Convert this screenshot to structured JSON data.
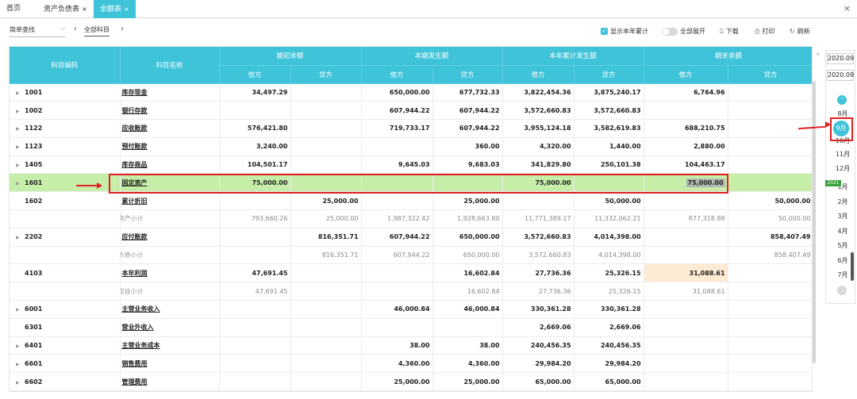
{
  "tabs": [
    {
      "label": "首页",
      "closable": false,
      "active": false
    },
    {
      "label": "资产负债表",
      "closable": true,
      "active": false
    },
    {
      "label": "余额表",
      "closable": true,
      "active": true
    }
  ],
  "close_glyph": "×",
  "toolbar": {
    "search_label": "简单查找",
    "subject_filter": "全部科目",
    "show_year_total_label": "显示本年累计",
    "show_year_total_checked": true,
    "expand_all_label": "全部展开",
    "download_label": "下载",
    "print_label": "打印",
    "refresh_label": "刷新"
  },
  "table": {
    "headers": {
      "code": "科目编码",
      "name": "科目名称",
      "groups": [
        "期初余额",
        "本期发生额",
        "本年累计发生额",
        "期末余额"
      ],
      "debit": "借方",
      "credit": "贷方"
    },
    "rows": [
      {
        "code": "1001",
        "expandable": true,
        "name": "库存现金",
        "type": "account",
        "values": [
          "34,497.29",
          "",
          "650,000.00",
          "677,732.33",
          "3,822,454.36",
          "3,875,240.17",
          "6,764.96",
          ""
        ]
      },
      {
        "code": "1002",
        "expandable": true,
        "name": "银行存款",
        "type": "account",
        "values": [
          "",
          "",
          "607,944.22",
          "607,944.22",
          "3,572,660.83",
          "3,572,660.83",
          "",
          ""
        ]
      },
      {
        "code": "1122",
        "expandable": true,
        "name": "应收账款",
        "type": "account",
        "values": [
          "576,421.80",
          "",
          "719,733.17",
          "607,944.22",
          "3,955,124.18",
          "3,582,619.83",
          "688,210.75",
          ""
        ]
      },
      {
        "code": "1123",
        "expandable": true,
        "name": "预付账款",
        "type": "account",
        "values": [
          "3,240.00",
          "",
          "",
          "360.00",
          "4,320.00",
          "1,440.00",
          "2,880.00",
          ""
        ]
      },
      {
        "code": "1405",
        "expandable": true,
        "name": "库存商品",
        "type": "account",
        "values": [
          "104,501.17",
          "",
          "9,645.03",
          "9,683.03",
          "341,829.80",
          "250,101.38",
          "104,463.17",
          ""
        ]
      },
      {
        "code": "1601",
        "expandable": true,
        "name": "固定资产",
        "type": "highlight",
        "values": [
          "75,000.00",
          "",
          "",
          "",
          "75,000.00",
          "",
          "75,000.00",
          ""
        ]
      },
      {
        "code": "1602",
        "expandable": false,
        "name": "累计折旧",
        "type": "account",
        "values": [
          "",
          "25,000.00",
          "",
          "25,000.00",
          "",
          "50,000.00",
          "",
          "50,000.00"
        ]
      },
      {
        "code": "",
        "expandable": false,
        "name": "资产小计",
        "type": "subtotal",
        "values": [
          "793,660.26",
          "25,000.00",
          "1,987,322.42",
          "1,928,663.80",
          "11,771,389.17",
          "11,332,062.21",
          "877,318.88",
          "50,000.00"
        ]
      },
      {
        "code": "2202",
        "expandable": true,
        "name": "应付账款",
        "type": "account",
        "values": [
          "",
          "816,351.71",
          "607,944.22",
          "650,000.00",
          "3,572,660.83",
          "4,014,398.00",
          "",
          "858,407.49"
        ]
      },
      {
        "code": "",
        "expandable": false,
        "name": "负债小计",
        "type": "subtotal",
        "values": [
          "",
          "816,351.71",
          "607,944.22",
          "650,000.00",
          "3,572,660.83",
          "4,014,398.00",
          "",
          "858,407.49"
        ]
      },
      {
        "code": "4103",
        "expandable": false,
        "name": "本年利润",
        "type": "account",
        "peach_col": 6,
        "values": [
          "47,691.45",
          "",
          "",
          "16,602.84",
          "27,736.36",
          "25,326.15",
          "31,088.61",
          ""
        ]
      },
      {
        "code": "",
        "expandable": false,
        "name": "权益小计",
        "type": "subtotal",
        "values": [
          "47,691.45",
          "",
          "",
          "16,602.84",
          "27,736.36",
          "25,326.15",
          "31,088.61",
          ""
        ]
      },
      {
        "code": "6001",
        "expandable": true,
        "name": "主营业务收入",
        "type": "account",
        "values": [
          "",
          "",
          "46,000.84",
          "46,000.84",
          "330,361.28",
          "330,361.28",
          "",
          ""
        ]
      },
      {
        "code": "6301",
        "expandable": false,
        "name": "营业外收入",
        "type": "account",
        "values": [
          "",
          "",
          "",
          "",
          "2,669.06",
          "2,669.06",
          "",
          ""
        ]
      },
      {
        "code": "6401",
        "expandable": true,
        "name": "主营业务成本",
        "type": "account",
        "values": [
          "",
          "",
          "38.00",
          "38.00",
          "240,456.35",
          "240,456.35",
          "",
          ""
        ]
      },
      {
        "code": "6601",
        "expandable": true,
        "name": "销售费用",
        "type": "account",
        "values": [
          "",
          "",
          "4,360.00",
          "4,360.00",
          "29,984.20",
          "29,984.20",
          "",
          ""
        ]
      },
      {
        "code": "6602",
        "expandable": true,
        "name": "管理费用",
        "type": "account",
        "values": [
          "",
          "",
          "25,000.00",
          "25,000.00",
          "65,000.00",
          "65,000.00",
          "",
          ""
        ]
      }
    ]
  },
  "period_panel": {
    "start_period": "2020.09",
    "end_period": "2020.09",
    "year_badge": "2021",
    "months_2020": [
      "8月",
      "9月",
      "10月",
      "11月",
      "12月"
    ],
    "active_month": "9月",
    "months_2021": [
      "1月",
      "2月",
      "3月",
      "4月",
      "5月",
      "6月",
      "7月"
    ]
  },
  "colors": {
    "accent": "#3ec3d9",
    "highlight_row": "#c6eea8",
    "annotation_red": "#e02020",
    "subtotal_icon": "#f5a623",
    "peach_cell": "#fdebd3"
  }
}
